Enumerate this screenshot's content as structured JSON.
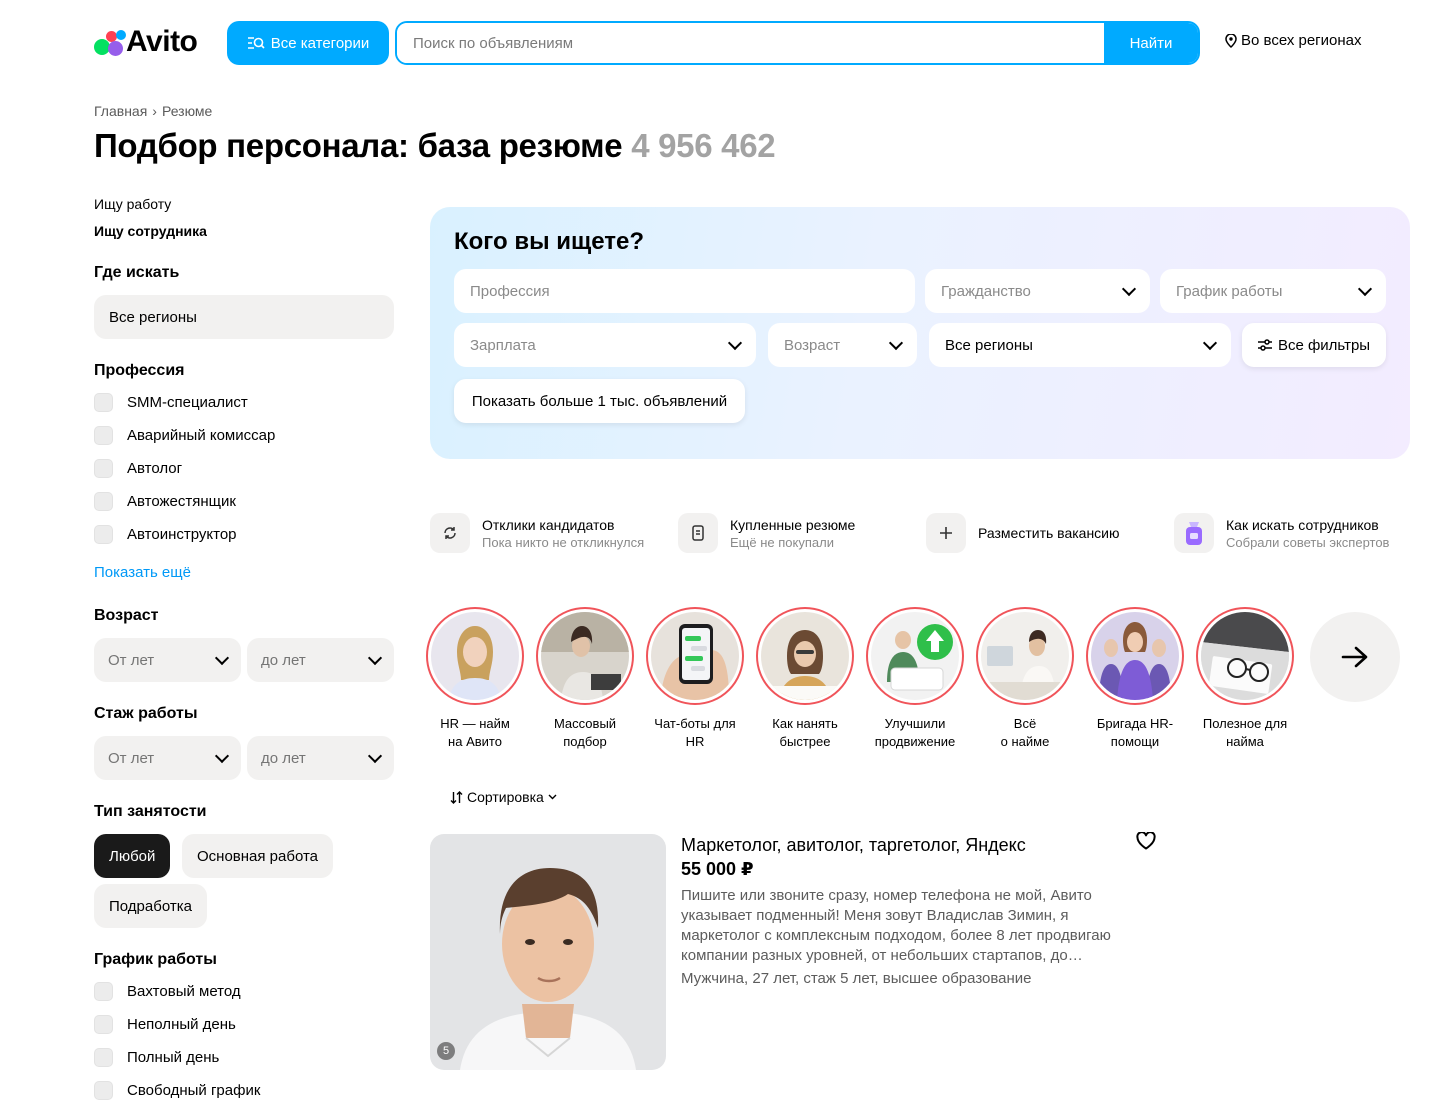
{
  "header": {
    "logo": "Avito",
    "categories_label": "Все категории",
    "search_placeholder": "Поиск по объявлениям",
    "search_button": "Найти",
    "region": "Во всех регионах"
  },
  "breadcrumb": [
    "Главная",
    "Резюме"
  ],
  "breadcrumb_sep": "›",
  "title": {
    "text": "Подбор персонала: база резюме",
    "count": "4 956 462"
  },
  "sidebar": {
    "mode_links": [
      "Ищу работу",
      "Ищу сотрудника"
    ],
    "where_title": "Где искать",
    "where_value": "Все регионы",
    "profession_title": "Профессия",
    "professions": [
      "SMM-специалист",
      "Аварийный комиссар",
      "Автолог",
      "Автожестянщик",
      "Автоинструктор"
    ],
    "show_more": "Показать ещё",
    "age_title": "Возраст",
    "age_from": "От лет",
    "age_to": "до лет",
    "exp_title": "Стаж работы",
    "exp_from": "От лет",
    "exp_to": "до лет",
    "employment_title": "Тип занятости",
    "employment": [
      "Любой",
      "Основная работа",
      "Подработка"
    ],
    "schedule_title": "График работы",
    "schedules": [
      "Вахтовый метод",
      "Неполный день",
      "Полный день",
      "Свободный график"
    ]
  },
  "hero": {
    "title": "Кого вы ищете?",
    "profession_placeholder": "Профессия",
    "citizenship": "Гражданство",
    "schedule": "График работы",
    "salary": "Зарплата",
    "age": "Возраст",
    "regions": "Все регионы",
    "all_filters": "Все фильтры",
    "show_button": "Показать больше 1 тыс. объявлений"
  },
  "quick_actions": [
    {
      "title": "Отклики кандидатов",
      "sub": "Пока никто не откликнулся",
      "icon": "refresh-icon"
    },
    {
      "title": "Купленные резюме",
      "sub": "Ещё не покупали",
      "icon": "document-icon"
    },
    {
      "title": "Разместить вакансию",
      "sub": "",
      "icon": "plus-icon"
    },
    {
      "title": "Как искать сотрудников",
      "sub": "Собрали советы экспертов",
      "icon": "badge-icon"
    }
  ],
  "stories": [
    {
      "line1": "HR — найм",
      "line2": "на Авито"
    },
    {
      "line1": "Массовый",
      "line2": "подбор"
    },
    {
      "line1": "Чат-боты для",
      "line2": "HR"
    },
    {
      "line1": "Как нанять",
      "line2": "быстрее"
    },
    {
      "line1": "Улучшили",
      "line2": "продвижение"
    },
    {
      "line1": "Всё",
      "line2": "о найме"
    },
    {
      "line1": "Бригада HR-",
      "line2": "помощи"
    },
    {
      "line1": "Полезное для",
      "line2": "найма"
    }
  ],
  "sort_label": "Сортировка",
  "listing": {
    "title": "Маркетолог, авитолог, таргетолог, Яндекс",
    "price": "55 000 ₽",
    "description": "Пишите или звоните сразу, номер телефона не мой, Авито указывает подменный! Меня зовут Владислав Зимин, я маркетолог с комплексным подходом, более 8 лет продвигаю компании разных уровней, от небольших стартапов, до…",
    "meta": "Мужчина, 27 лет, стаж 5 лет, высшее образование",
    "photo_count": "5"
  },
  "colors": {
    "accent": "#00aaff",
    "link": "#0099f7",
    "story_ring": "#f0545a"
  }
}
